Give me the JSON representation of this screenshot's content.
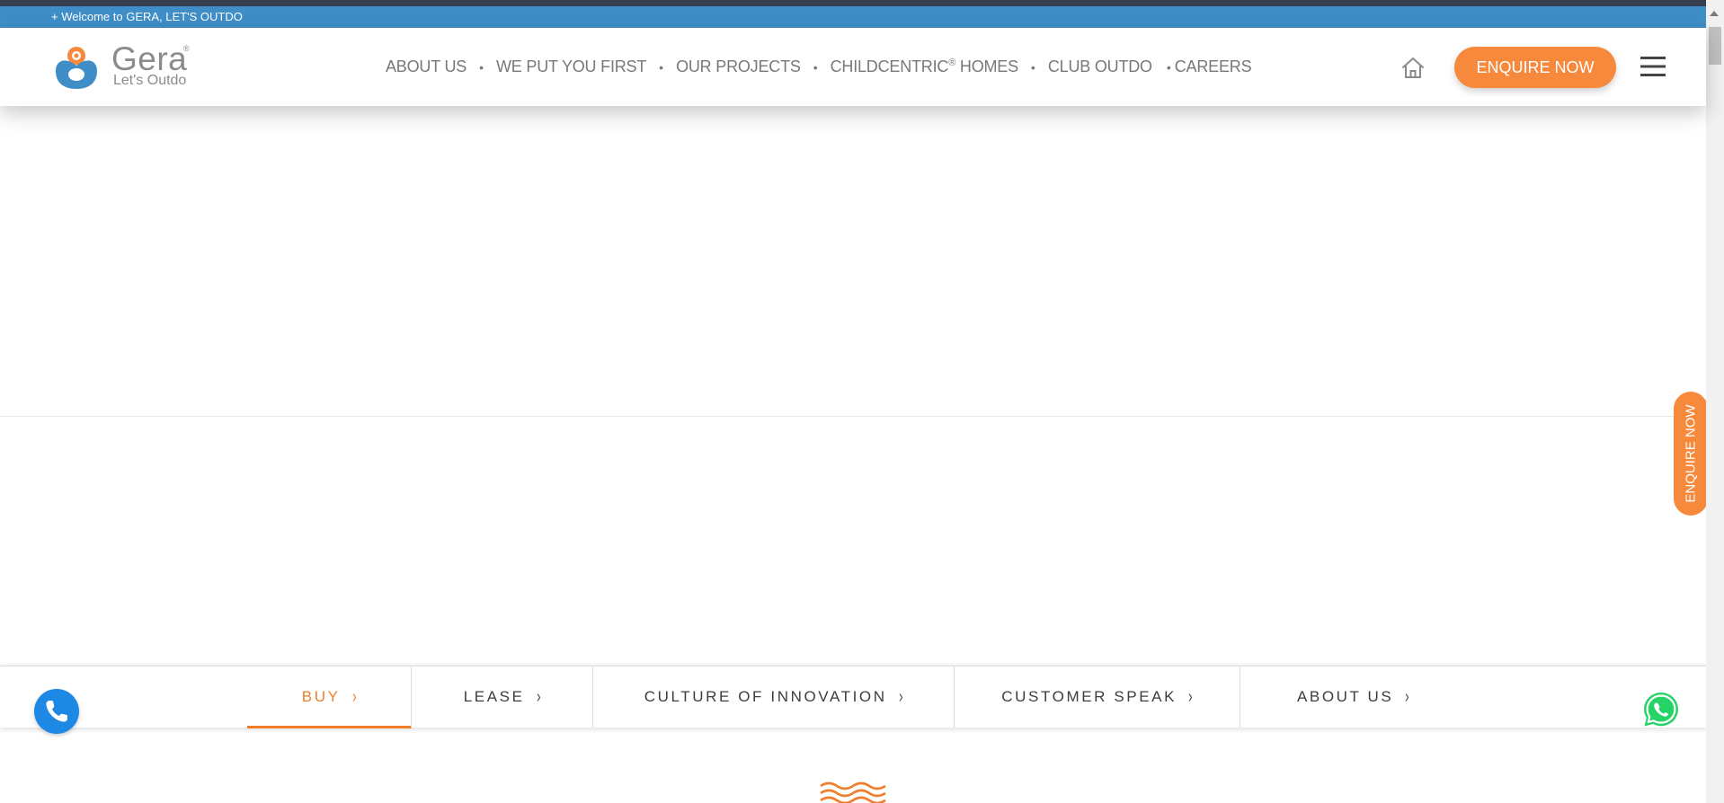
{
  "welcome_bar": {
    "text": "+ Welcome to GERA, LET'S OUTDO"
  },
  "logo": {
    "name": "Gera",
    "tagline": "Let's Outdo",
    "reg": "®"
  },
  "nav": {
    "about": "ABOUT US",
    "first": "WE PUT YOU FIRST",
    "projects": "OUR PROJECTS",
    "childcentric": "CHILDCENTRIC",
    "childcentric_reg": "®",
    "homes": " HOMES",
    "club": "CLUB OUTDO",
    "careers": "CAREERS",
    "separator": "•"
  },
  "header": {
    "enquire_label": "ENQUIRE NOW",
    "home_icon": "home-icon",
    "menu_icon": "hamburger-menu-icon"
  },
  "side_enquire": {
    "label": "ENQUIRE NOW"
  },
  "tabs": [
    {
      "label": "BUY",
      "active": true
    },
    {
      "label": "LEASE",
      "active": false
    },
    {
      "label": "CULTURE OF INNOVATION",
      "active": false
    },
    {
      "label": "CUSTOMER SPEAK",
      "active": false
    },
    {
      "label": "ABOUT US",
      "active": false
    }
  ],
  "tab_chevron": "›",
  "colors": {
    "brand_orange": "#f7893d",
    "brand_blue": "#3f8ec8",
    "phone_blue": "#1e88e5",
    "whatsapp_green": "#25d366",
    "text_grey": "#77787b"
  },
  "icons": {
    "phone": "phone-icon",
    "whatsapp": "whatsapp-icon",
    "waves": "waves-icon"
  }
}
